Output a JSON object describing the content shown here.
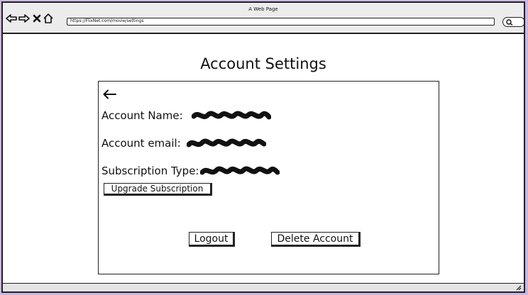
{
  "window": {
    "title": "A Web Page"
  },
  "browser": {
    "url": "https://FlixNet.com/movie/settings",
    "icons": [
      "back-icon",
      "forward-icon",
      "close-icon",
      "home-icon",
      "search-icon"
    ]
  },
  "page": {
    "title": "Account Settings",
    "back_icon": "left-arrow-icon"
  },
  "account": {
    "name_label": "Account Name:",
    "email_label": "Account email:",
    "subscription_label": "Subscription Type:",
    "values_redacted": true
  },
  "actions": {
    "upgrade_label": "Upgrade Subscription",
    "logout_label": "Logout",
    "delete_label": "Delete Account"
  },
  "colors": {
    "desktop_background": "#c8b6e2",
    "page_background": "#ffffff",
    "chrome_background": "#ececec",
    "ink": "#111111"
  }
}
